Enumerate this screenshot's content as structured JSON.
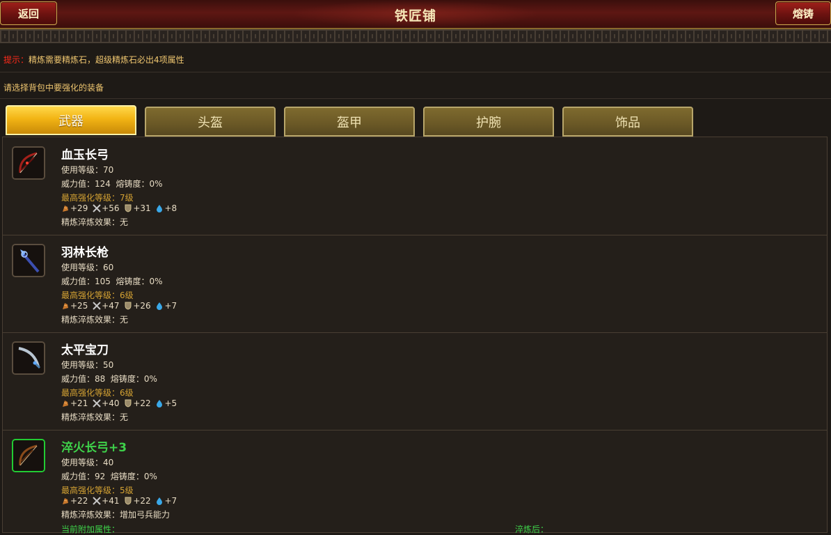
{
  "header": {
    "title": "铁匠铺",
    "back_label": "返回",
    "forge_label": "熔铸"
  },
  "tip": {
    "label": "提示：",
    "text": "精炼需要精炼石，超级精炼石必出4项属性"
  },
  "instruction": "请选择背包中要强化的装备",
  "tabs": [
    {
      "label": "武器",
      "active": true
    },
    {
      "label": "头盔",
      "active": false
    },
    {
      "label": "盔甲",
      "active": false
    },
    {
      "label": "护腕",
      "active": false
    },
    {
      "label": "饰品",
      "active": false
    }
  ],
  "items": [
    {
      "name": "血玉长弓",
      "level": "使用等级：70",
      "power": "威力值：124",
      "durability": "熔铸度：0%",
      "max_enhance": "最高强化等级：7级",
      "stats": [
        "+29",
        "+56",
        "+31",
        "+8"
      ],
      "refine": "精炼淬炼效果：无",
      "icon": "bow-icon"
    },
    {
      "name": "羽林长枪",
      "level": "使用等级：60",
      "power": "威力值：105",
      "durability": "熔铸度：0%",
      "max_enhance": "最高强化等级：6级",
      "stats": [
        "+25",
        "+47",
        "+26",
        "+7"
      ],
      "refine": "精炼淬炼效果：无",
      "icon": "spear-icon"
    },
    {
      "name": "太平宝刀",
      "level": "使用等级：50",
      "power": "威力值：88",
      "durability": "熔铸度：0%",
      "max_enhance": "最高强化等级：6级",
      "stats": [
        "+21",
        "+40",
        "+22",
        "+5"
      ],
      "refine": "精炼淬炼效果：无",
      "icon": "sword-icon"
    },
    {
      "name": "淬火长弓+3",
      "level": "使用等级：40",
      "power": "威力值：92",
      "durability": "熔铸度：0%",
      "max_enhance": "最高强化等级：5级",
      "stats": [
        "+22",
        "+41",
        "+22",
        "+7"
      ],
      "refine": "精炼淬炼效果：增加弓兵能力",
      "current_attr": "当前附加属性：",
      "after_refine": "淬炼后：",
      "icon": "bow-icon"
    }
  ],
  "stat_icons": [
    "strength-icon",
    "attack-icon",
    "defense-icon",
    "mana-icon"
  ],
  "colors": {
    "tip_label": "#ff2a1a",
    "gold_text": "#f0c770",
    "active_tab": "#f2b414",
    "highlight_green": "#3ed24a"
  }
}
